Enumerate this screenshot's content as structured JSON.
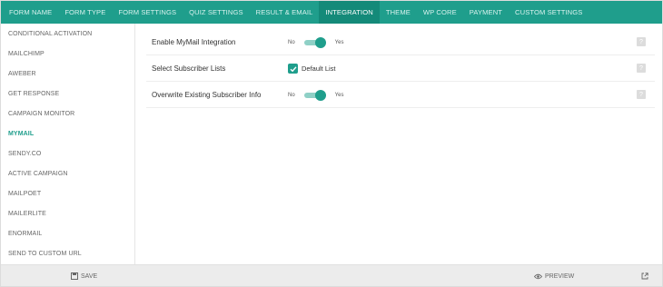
{
  "tabs": [
    {
      "label": "FORM NAME"
    },
    {
      "label": "FORM TYPE"
    },
    {
      "label": "FORM SETTINGS"
    },
    {
      "label": "QUIZ SETTINGS"
    },
    {
      "label": "RESULT & EMAIL"
    },
    {
      "label": "INTEGRATION"
    },
    {
      "label": "THEME"
    },
    {
      "label": "WP CORE"
    },
    {
      "label": "PAYMENT"
    },
    {
      "label": "CUSTOM SETTINGS"
    }
  ],
  "active_tab": "INTEGRATION",
  "sidebar": {
    "items": [
      {
        "label": "CONDITIONAL ACTIVATION"
      },
      {
        "label": "MAILCHIMP"
      },
      {
        "label": "AWEBER"
      },
      {
        "label": "GET RESPONSE"
      },
      {
        "label": "CAMPAIGN MONITOR"
      },
      {
        "label": "MYMAIL"
      },
      {
        "label": "SENDY.CO"
      },
      {
        "label": "ACTIVE CAMPAIGN"
      },
      {
        "label": "MAILPOET"
      },
      {
        "label": "MAILERLITE"
      },
      {
        "label": "ENORMAIL"
      },
      {
        "label": "SEND TO CUSTOM URL"
      }
    ],
    "active_item": "MYMAIL"
  },
  "settings": {
    "enable_integration": {
      "label": "Enable MyMail Integration",
      "off_label": "No",
      "on_label": "Yes",
      "value": "Yes"
    },
    "subscriber_lists": {
      "label": "Select Subscriber Lists",
      "option_label": "Default List",
      "checked": true
    },
    "overwrite_info": {
      "label": "Overwrite Existing Subscriber Info",
      "off_label": "No",
      "on_label": "Yes",
      "value": "Yes"
    },
    "help_icon": "?"
  },
  "footer": {
    "save_label": "SAVE",
    "preview_label": "PREVIEW"
  },
  "colors": {
    "accent": "#1f9e8c",
    "accent_dark": "#148a79",
    "switch_track": "#8fd0c6",
    "footer_bg": "#ececec"
  },
  "icons": {
    "save": "floppy-disk-icon",
    "preview": "eye-icon",
    "popout": "external-link-icon",
    "help": "question-icon",
    "check": "checkmark-icon"
  }
}
